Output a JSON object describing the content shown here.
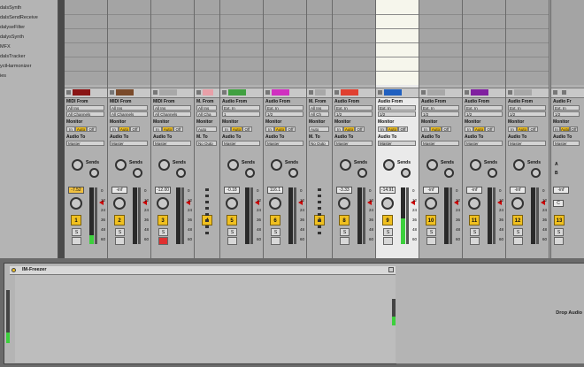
{
  "browser": {
    "items": [
      "dalsSynth",
      "dalsSendReceive",
      "dalyseFilter",
      "dalysSynth",
      "MFX",
      "dalsTracker",
      "yctHarmonizer",
      "ies"
    ]
  },
  "labels": {
    "midi_from": "MIDI From",
    "audio_from": "Audio From",
    "m_from": "M. From",
    "monitor": "Monitor",
    "audio_to": "Audio To",
    "midi_to": "MIDI To",
    "m_to": "M. To",
    "a_to": "A. To",
    "sends": "Sends",
    "in": "In",
    "auto": "Auto",
    "off": "Off",
    "s": "S",
    "a": "A",
    "b": "B",
    "c": "C"
  },
  "tracks": [
    {
      "color": "#8a1515",
      "from_label": "MIDI From",
      "from": "All Ins",
      "channel": "All Channels",
      "monitor": "Auto",
      "to": "Master",
      "vol": "-7.52",
      "vol_hl": true,
      "num": "1",
      "meter": 0.15,
      "rec": false,
      "selected": false,
      "has_col2": false
    },
    {
      "color": "#7a4a2a",
      "from_label": "MIDI From",
      "from": "All Ins",
      "channel": "All Channels",
      "monitor": "Auto",
      "to": "Master",
      "vol": "-inf",
      "vol_hl": false,
      "num": "2",
      "meter": 0,
      "rec": false,
      "selected": false,
      "has_col2": false
    },
    {
      "color": "#a8a8a8",
      "from_label": "MIDI From",
      "from": "All Ins",
      "channel": "All Channels",
      "monitor": "Auto",
      "to": "Master",
      "vol": "-12.00",
      "vol_hl": false,
      "num": "3",
      "meter": 0,
      "rec": true,
      "selected": false,
      "has_col2": false
    },
    {
      "color": "#e8a0a8",
      "from_label": "M. From",
      "from": "All Ins",
      "channel": "All Cha",
      "monitor": "Auto",
      "to": "No Outp",
      "vol": "",
      "vol_hl": false,
      "num": "4",
      "meter": 0,
      "rec": false,
      "selected": false,
      "has_col2": false
    },
    {
      "color": "#40a040",
      "from_label": "Audio From",
      "from": "Ext. In",
      "channel": "1",
      "monitor": "Auto",
      "to": "Master",
      "vol": "-0.18",
      "vol_hl": false,
      "num": "5",
      "meter": 0,
      "rec": false,
      "selected": false,
      "has_col2": false
    },
    {
      "color": "#d030c0",
      "from_label": "Audio From",
      "from": "Ext. In",
      "channel": "1/2",
      "monitor": "Auto",
      "to": "Master",
      "vol": "116.1",
      "vol_hl": false,
      "num": "6",
      "meter": 0,
      "rec": false,
      "selected": false,
      "has_col2": false
    },
    {
      "color": "#a8a8a8",
      "from_label": "M. From",
      "from": "All Ins",
      "channel": "All Ch",
      "monitor": "Auto",
      "to": "No Outp",
      "vol": "",
      "vol_hl": false,
      "num": "7",
      "meter": 0,
      "rec": false,
      "selected": false,
      "has_col2": false
    },
    {
      "color": "#e04030",
      "from_label": "Audio From",
      "from": "Ext. In",
      "channel": "1/2",
      "monitor": "Auto",
      "to": "Master",
      "vol": "-3.33",
      "vol_hl": false,
      "num": "8",
      "meter": 0,
      "rec": false,
      "selected": false,
      "has_col2": false
    },
    {
      "color": "#2060c0",
      "from_label": "Audio From",
      "from": "Ext. In",
      "channel": "1/2",
      "monitor": "Auto",
      "to": "Master",
      "vol": "-14.91",
      "vol_hl": false,
      "num": "9",
      "meter": 0.45,
      "rec": false,
      "selected": true,
      "has_col2": false
    },
    {
      "color": "#a8a8a8",
      "from_label": "Audio From",
      "from": "Ext. In",
      "channel": "1/2",
      "monitor": "Auto",
      "to": "Master",
      "vol": "-inf",
      "vol_hl": false,
      "num": "10",
      "meter": 0,
      "rec": false,
      "selected": false,
      "has_col2": false
    },
    {
      "color": "#8020a0",
      "from_label": "Audio From",
      "from": "Ext. In",
      "channel": "1/2",
      "monitor": "Auto",
      "to": "Master",
      "vol": "-inf",
      "vol_hl": false,
      "num": "11",
      "meter": 0,
      "rec": false,
      "selected": false,
      "has_col2": false
    },
    {
      "color": "#a8a8a8",
      "from_label": "Audio From",
      "from": "Ext. In",
      "channel": "1/2",
      "monitor": "Auto",
      "to": "Master",
      "vol": "-inf",
      "vol_hl": false,
      "num": "12",
      "meter": 0,
      "rec": false,
      "selected": false,
      "has_col2": false
    }
  ],
  "right_track": {
    "from_label": "Audio Fr",
    "from": "Ext. In",
    "channel": "1/2",
    "monitor": "Auto",
    "to": "Master",
    "vol": "-inf",
    "num": "13"
  },
  "scale_marks": [
    "0",
    "12",
    "24",
    "36",
    "48",
    "60"
  ],
  "device": {
    "title": "IM-Freezer"
  },
  "drop_text": "Drop Audio"
}
